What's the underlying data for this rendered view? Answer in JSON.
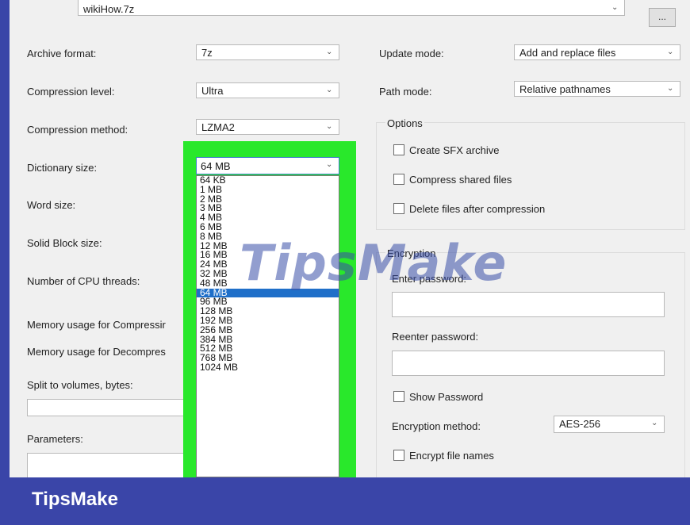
{
  "archive": {
    "name": "wikiHow.7z"
  },
  "left": {
    "archive_format": {
      "label": "Archive format:",
      "value": "7z"
    },
    "compression_level": {
      "label": "Compression level:",
      "value": "Ultra"
    },
    "compression_method": {
      "label": "Compression method:",
      "value": "LZMA2"
    },
    "dictionary_size": {
      "label": "Dictionary size:",
      "value": "64 MB"
    },
    "word_size": {
      "label": "Word size:"
    },
    "solid_block_size": {
      "label": "Solid Block size:"
    },
    "cpu_threads": {
      "label": "Number of CPU threads:"
    },
    "mem_compress": {
      "label": "Memory usage for Compressir"
    },
    "mem_decompress": {
      "label": "Memory usage for Decompres"
    },
    "split_volumes": {
      "label": "Split to volumes, bytes:"
    },
    "parameters": {
      "label": "Parameters:"
    }
  },
  "dictionary_options": [
    "64 KB",
    "1 MB",
    "2 MB",
    "3 MB",
    "4 MB",
    "6 MB",
    "8 MB",
    "12 MB",
    "16 MB",
    "24 MB",
    "32 MB",
    "48 MB",
    "64 MB",
    "96 MB",
    "128 MB",
    "192 MB",
    "256 MB",
    "384 MB",
    "512 MB",
    "768 MB",
    "1024 MB"
  ],
  "dictionary_selected_index": 12,
  "right": {
    "update_mode": {
      "label": "Update mode:",
      "value": "Add and replace files"
    },
    "path_mode": {
      "label": "Path mode:",
      "value": "Relative pathnames"
    },
    "options": {
      "title": "Options",
      "create_sfx": "Create SFX archive",
      "compress_shared": "Compress shared files",
      "delete_after": "Delete files after compression"
    },
    "encryption": {
      "title": "Encryption",
      "enter_password": "Enter password:",
      "reenter_password": "Reenter password:",
      "show_password": "Show Password",
      "method_label": "Encryption method:",
      "method_value": "AES-256",
      "encrypt_names": "Encrypt file names"
    }
  },
  "browse_button": "...",
  "watermark": "TipsMake",
  "footer": {
    "brand": "TipsMake"
  },
  "colors": {
    "highlight": "#29e82b",
    "selection": "#1f6fc9",
    "footer": "#3a45a8"
  }
}
